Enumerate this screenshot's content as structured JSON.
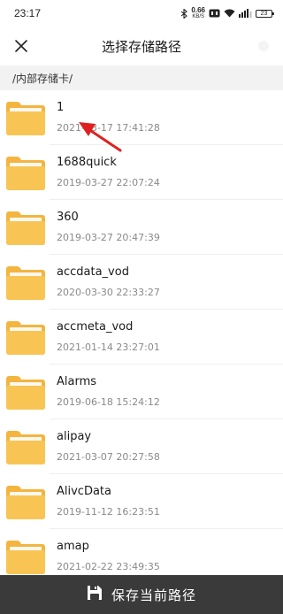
{
  "status_bar": {
    "time": "23:17",
    "net_speed_value": "0.66",
    "net_speed_unit": "KB/S",
    "battery": "23",
    "icons": [
      "bluetooth-icon",
      "net-speed-icon",
      "hd-icon",
      "wifi-icon",
      "signal-icon",
      "battery-icon"
    ]
  },
  "header": {
    "title": "选择存储路径",
    "close_icon": "close-icon"
  },
  "path": {
    "current": "/内部存储卡/"
  },
  "files": [
    {
      "name": "1",
      "date": "2021-03-17 17:41:28"
    },
    {
      "name": "1688quick",
      "date": "2019-03-27 22:07:24"
    },
    {
      "name": "360",
      "date": "2019-03-27 20:47:39"
    },
    {
      "name": "accdata_vod",
      "date": "2020-03-30 22:33:27"
    },
    {
      "name": "accmeta_vod",
      "date": "2021-01-14 23:27:01"
    },
    {
      "name": "Alarms",
      "date": "2019-06-18 15:24:12"
    },
    {
      "name": "alipay",
      "date": "2021-03-07 20:27:58"
    },
    {
      "name": "AlivcData",
      "date": "2019-11-12 16:23:51"
    },
    {
      "name": "amap",
      "date": "2021-02-22 23:49:35"
    }
  ],
  "footer": {
    "save_label": "保存当前路径",
    "save_icon": "floppy-disk-icon"
  },
  "colors": {
    "folder": "#f8c554",
    "folder_dark": "#f3b53f",
    "footer_bg": "#3a3a3a",
    "annotation_arrow": "#e02020",
    "path_bar_bg": "#f2f2f2"
  }
}
